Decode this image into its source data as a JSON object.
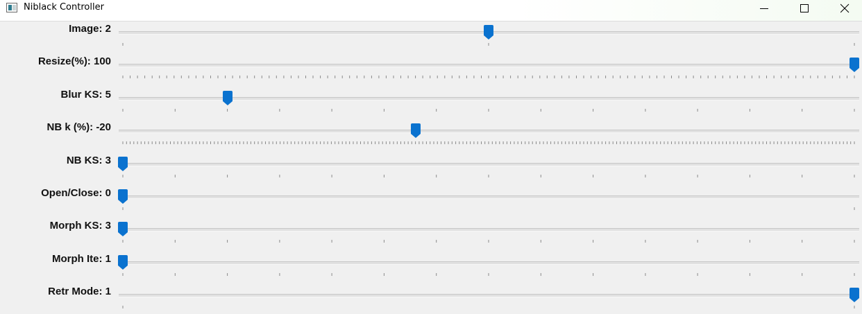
{
  "window": {
    "title": "Niblack Controller",
    "icons": {
      "app": "app-window-icon",
      "minimize": "minimize-icon",
      "maximize": "maximize-icon",
      "close": "close-icon"
    }
  },
  "colors": {
    "thumb": "#0a72cf",
    "track": "#e1e1e1",
    "tick": "#8a8a8a",
    "background": "#f0f0f0"
  },
  "trackbars": [
    {
      "id": "image",
      "label": "Image: 2",
      "value": 2,
      "min": 0,
      "max": 4,
      "tick_count": 2
    },
    {
      "id": "resize",
      "label": "Resize(%): 100",
      "value": 100,
      "min": 0,
      "max": 100,
      "tick_count": 100
    },
    {
      "id": "blur-ks",
      "label": "Blur KS: 5",
      "value": 5,
      "min": 3,
      "max": 17,
      "tick_count": 14
    },
    {
      "id": "nb-k",
      "label": "NB k (%): -20",
      "value": -20,
      "min": -100,
      "max": 100,
      "tick_count": 200
    },
    {
      "id": "nb-ks",
      "label": "NB KS: 3",
      "value": 3,
      "min": 3,
      "max": 17,
      "tick_count": 14
    },
    {
      "id": "open-close",
      "label": "Open/Close: 0",
      "value": 0,
      "min": 0,
      "max": 1,
      "tick_count": 1
    },
    {
      "id": "morph-ks",
      "label": "Morph KS: 3",
      "value": 3,
      "min": 3,
      "max": 17,
      "tick_count": 14
    },
    {
      "id": "morph-ite",
      "label": "Morph Ite: 1",
      "value": 1,
      "min": 1,
      "max": 15,
      "tick_count": 14
    },
    {
      "id": "retr-mode",
      "label": "Retr Mode: 1",
      "value": 1,
      "min": 0,
      "max": 1,
      "tick_count": 1
    }
  ]
}
